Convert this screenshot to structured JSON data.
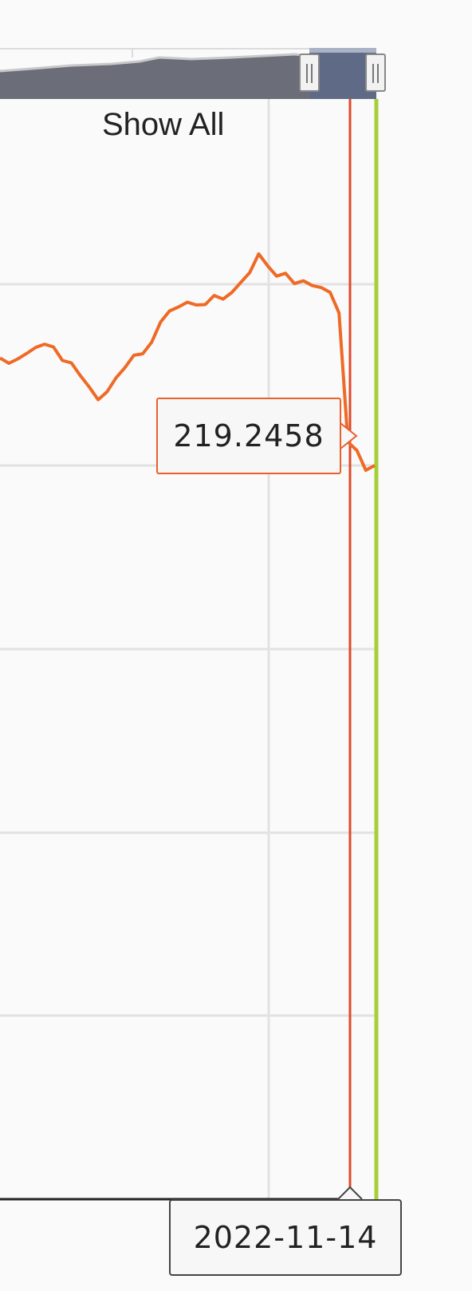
{
  "navigator": {
    "show_all_label": "Show All"
  },
  "tooltip": {
    "value": "219.2458",
    "date": "2022-11-14"
  },
  "colors": {
    "series": "#ee6a26",
    "crosshair": "#e04a2a",
    "range_end_line": "#a6cf3a",
    "grid": "#e2e2e2",
    "navigator_fill": "#6b6e78",
    "navigator_selected": "#5f6a86"
  },
  "chart_data": {
    "type": "line",
    "series": [
      {
        "values": [
          242.5,
          241.2,
          242.3,
          243.7,
          245.2,
          246.0,
          245.3,
          241.9,
          241.3,
          238.1,
          235.2,
          232.0,
          234.0,
          237.5,
          240.1,
          243.2,
          243.6,
          246.5,
          251.6,
          254.4,
          255.4,
          256.6,
          255.9,
          256.0,
          258.3,
          257.4,
          259.1,
          261.6,
          264.1,
          268.8,
          265.8,
          263.2,
          263.9,
          261.3,
          262.0,
          260.8,
          260.3,
          259.1,
          253.9,
          221.3,
          219.2,
          214.2,
          215.4
        ]
      }
    ],
    "highlighted_point": {
      "date": "2022-11-14",
      "value": 219.2458
    },
    "grid": true
  }
}
